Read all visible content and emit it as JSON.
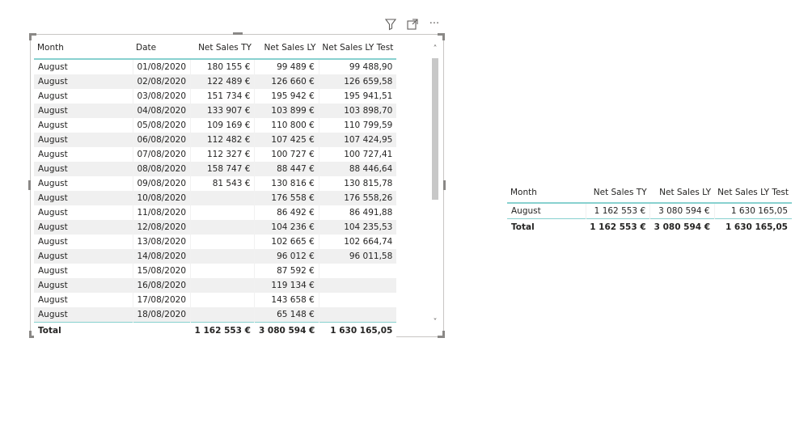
{
  "toolbar": {
    "filter_icon": "funnel-icon",
    "focus_icon": "focus-mode-icon",
    "more_label": "···"
  },
  "table1": {
    "headers": [
      "Month",
      "Date",
      "Net Sales TY",
      "Net Sales LY",
      "Net Sales LY Test"
    ],
    "rows": [
      [
        "August",
        "01/08/2020",
        "180 155 €",
        "99 489 €",
        "99 488,90"
      ],
      [
        "August",
        "02/08/2020",
        "122 489 €",
        "126 660 €",
        "126 659,58"
      ],
      [
        "August",
        "03/08/2020",
        "151 734 €",
        "195 942 €",
        "195 941,51"
      ],
      [
        "August",
        "04/08/2020",
        "133 907 €",
        "103 899 €",
        "103 898,70"
      ],
      [
        "August",
        "05/08/2020",
        "109 169 €",
        "110 800 €",
        "110 799,59"
      ],
      [
        "August",
        "06/08/2020",
        "112 482 €",
        "107 425 €",
        "107 424,95"
      ],
      [
        "August",
        "07/08/2020",
        "112 327 €",
        "100 727 €",
        "100 727,41"
      ],
      [
        "August",
        "08/08/2020",
        "158 747 €",
        "88 447 €",
        "88 446,64"
      ],
      [
        "August",
        "09/08/2020",
        "81 543 €",
        "130 816 €",
        "130 815,78"
      ],
      [
        "August",
        "10/08/2020",
        "",
        "176 558 €",
        "176 558,26"
      ],
      [
        "August",
        "11/08/2020",
        "",
        "86 492 €",
        "86 491,88"
      ],
      [
        "August",
        "12/08/2020",
        "",
        "104 236 €",
        "104 235,53"
      ],
      [
        "August",
        "13/08/2020",
        "",
        "102 665 €",
        "102 664,74"
      ],
      [
        "August",
        "14/08/2020",
        "",
        "96 012 €",
        "96 011,58"
      ],
      [
        "August",
        "15/08/2020",
        "",
        "87 592 €",
        ""
      ],
      [
        "August",
        "16/08/2020",
        "",
        "119 134 €",
        ""
      ],
      [
        "August",
        "17/08/2020",
        "",
        "143 658 €",
        ""
      ],
      [
        "August",
        "18/08/2020",
        "",
        "65 148 €",
        ""
      ]
    ],
    "total": [
      "Total",
      "",
      "1 162 553 €",
      "3 080 594 €",
      "1 630 165,05"
    ]
  },
  "table2": {
    "headers": [
      "Month",
      "Net Sales TY",
      "Net Sales LY",
      "Net Sales LY Test"
    ],
    "rows": [
      [
        "August",
        "1 162 553 €",
        "3 080 594 €",
        "1 630 165,05"
      ]
    ],
    "total": [
      "Total",
      "1 162 553 €",
      "3 080 594 €",
      "1 630 165,05"
    ]
  },
  "scrollbar": {
    "up_label": "˄",
    "down_label": "˅"
  }
}
